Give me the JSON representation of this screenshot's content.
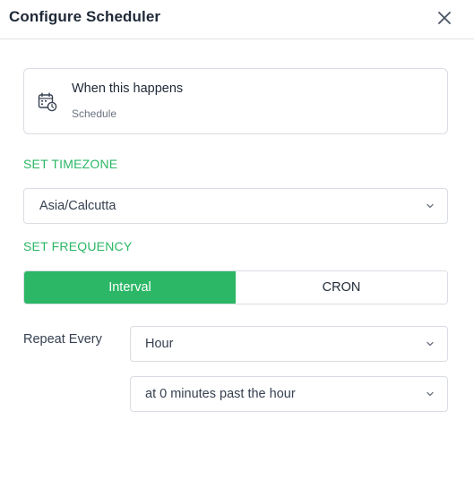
{
  "header": {
    "title": "Configure Scheduler",
    "close_icon": "close-icon"
  },
  "trigger": {
    "icon": "calendar-clock-icon",
    "title": "When this happens",
    "subtitle": "Schedule"
  },
  "timezone": {
    "label": "SET TIMEZONE",
    "selected": "Asia/Calcutta"
  },
  "frequency": {
    "label": "SET FREQUENCY",
    "tabs": [
      {
        "label": "Interval",
        "active": true
      },
      {
        "label": "CRON",
        "active": false
      }
    ],
    "repeat_label": "Repeat Every",
    "unit_selected": "Hour",
    "minute_selected": "at 0 minutes past the hour"
  },
  "colors": {
    "accent": "#2bb765",
    "border": "#d9dde3",
    "text": "#1f2937"
  }
}
